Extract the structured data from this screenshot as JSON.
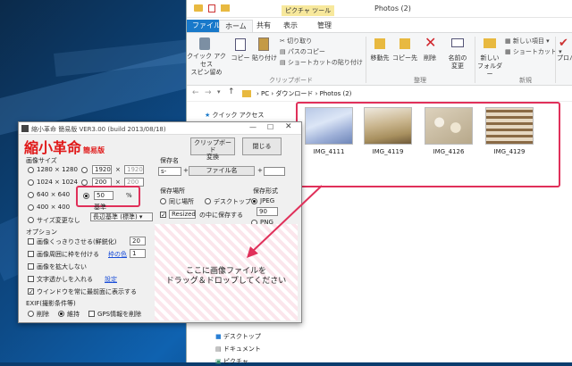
{
  "explorer": {
    "title": "Photos (2)",
    "context_tab": "ピクチャ ツール",
    "tabs": [
      "ファイル",
      "ホーム",
      "共有",
      "表示",
      "管理"
    ],
    "ribbon": {
      "pin": "クイック アクセス",
      "pin2": "スピン留め",
      "copy": "コピー",
      "paste": "貼り付け",
      "cut": "切り取り",
      "copy_path": "パスのコピー",
      "paste_shortcut": "ショートカットの貼り付け",
      "move_to": "移動先",
      "copy_to": "コピー先",
      "delete": "削除",
      "rename": "名前の",
      "rename2": "変更",
      "new_folder": "新しい",
      "new_folder2": "フォルダー",
      "new_item": "新しい項目",
      "shortcut": "ショートカット",
      "properties": "プロパ",
      "group_clipboard": "クリップボード",
      "group_organize": "整理",
      "group_new": "新規"
    },
    "address": [
      "PC",
      "ダウンロード",
      "Photos (2)"
    ],
    "nav_items": [
      "クイック アクセス",
      "デスクトップ",
      "ドキュメント",
      "ピクチャ"
    ],
    "photos": [
      "IMG_4111",
      "IMG_4119",
      "IMG_4126",
      "IMG_4129"
    ]
  },
  "app": {
    "title": "縮小革命 簡易版  VER3.00 (build 2013/08/18)",
    "logo": "縮小革命",
    "logo_sub": "簡易版",
    "size_label": "画像サイズ",
    "sizes": [
      "1280 × 1280",
      "1024 × 1024",
      "640 × 640",
      "400 × 400"
    ],
    "custom_w": "1920",
    "custom_x": "×",
    "custom_h": "1920",
    "custom2_w": "200",
    "custom2_h": "200",
    "percent_value": "50",
    "percent_unit": "%",
    "basis_label": "基準",
    "basis_value": "長辺基準 (標準)",
    "no_resize": "サイズ変更なし",
    "clip_button": "クリップボード変換",
    "close_button": "閉じる",
    "savename_label": "保存名",
    "prefix": "s-",
    "plus": "+",
    "filename_btn": "ファイル名",
    "suffix": "",
    "savedir_label": "保存場所",
    "same_place": "同じ場所",
    "desktop": "デスクトップ",
    "resized_folder": "Resized",
    "save_inside": "の中に保存する",
    "format_label": "保存形式",
    "jpeg": "JPEG",
    "quality": "90",
    "png": "PNG",
    "options_label": "オプション",
    "sharpen": "画像くっきりさせる(鮮鋭化)",
    "sharpen_val": "20",
    "border": "画像周囲に枠を付ける",
    "border_color": "枠の色",
    "border_val": "1",
    "no_enlarge": "画像を拡大しない",
    "text_insert": "文字透かしを入れる",
    "text_setting": "設定",
    "always_top": "ウインドウを常に最前面に表示する",
    "exif_label": "EXIF(撮影条件等)",
    "exif_delete": "削除",
    "exif_keep": "維持",
    "exif_gps": "GPS情報を削除",
    "drop_line1": "ここに画像ファイルを",
    "drop_line2": "ドラッグ＆ドロップしてください"
  },
  "colors": {
    "highlight": "#e0305a",
    "logo": "#e01818",
    "ribbon_blue": "#1979ca"
  }
}
